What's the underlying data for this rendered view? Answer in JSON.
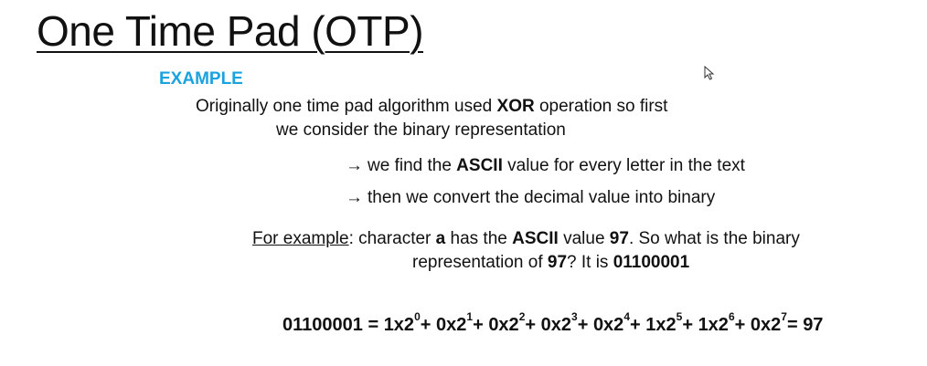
{
  "slide": {
    "title": "One Time Pad (OTP)",
    "example_label": "EXAMPLE",
    "intro": {
      "part1": "Originally one time pad algorithm used ",
      "bold1": "XOR",
      "part2": " operation so first",
      "line2": "we consider the binary representation"
    },
    "bullets": [
      {
        "arrow": "→",
        "pre": "we find the ",
        "bold": "ASCII",
        "post": " value for every letter in the text"
      },
      {
        "arrow": "→",
        "text": "then we convert the decimal value into binary"
      }
    ],
    "for_example": {
      "label": "For example",
      "colon": ": character ",
      "char": "a",
      "mid1": " has the ",
      "ascii": "ASCII",
      "mid2": " value ",
      "value": "97",
      "mid3": ". So what is the binary",
      "line2_pre": "representation of ",
      "line2_value": "97",
      "line2_mid": "? It is ",
      "line2_binary": "01100001"
    },
    "formula": {
      "lhs": "01100001 = ",
      "terms": [
        {
          "coef": "1x2",
          "exp": "0",
          "sep": "+ "
        },
        {
          "coef": "0x2",
          "exp": "1",
          "sep": "+ "
        },
        {
          "coef": "0x2",
          "exp": "2",
          "sep": "+ "
        },
        {
          "coef": "0x2",
          "exp": "3",
          "sep": "+ "
        },
        {
          "coef": "0x2",
          "exp": "4",
          "sep": "+ "
        },
        {
          "coef": "1x2",
          "exp": "5",
          "sep": "+ "
        },
        {
          "coef": "1x2",
          "exp": "6",
          "sep": "+ "
        },
        {
          "coef": "0x2",
          "exp": "7",
          "sep": "= "
        }
      ],
      "rhs": "97"
    },
    "cursor_icon": "mouse-pointer-icon"
  }
}
